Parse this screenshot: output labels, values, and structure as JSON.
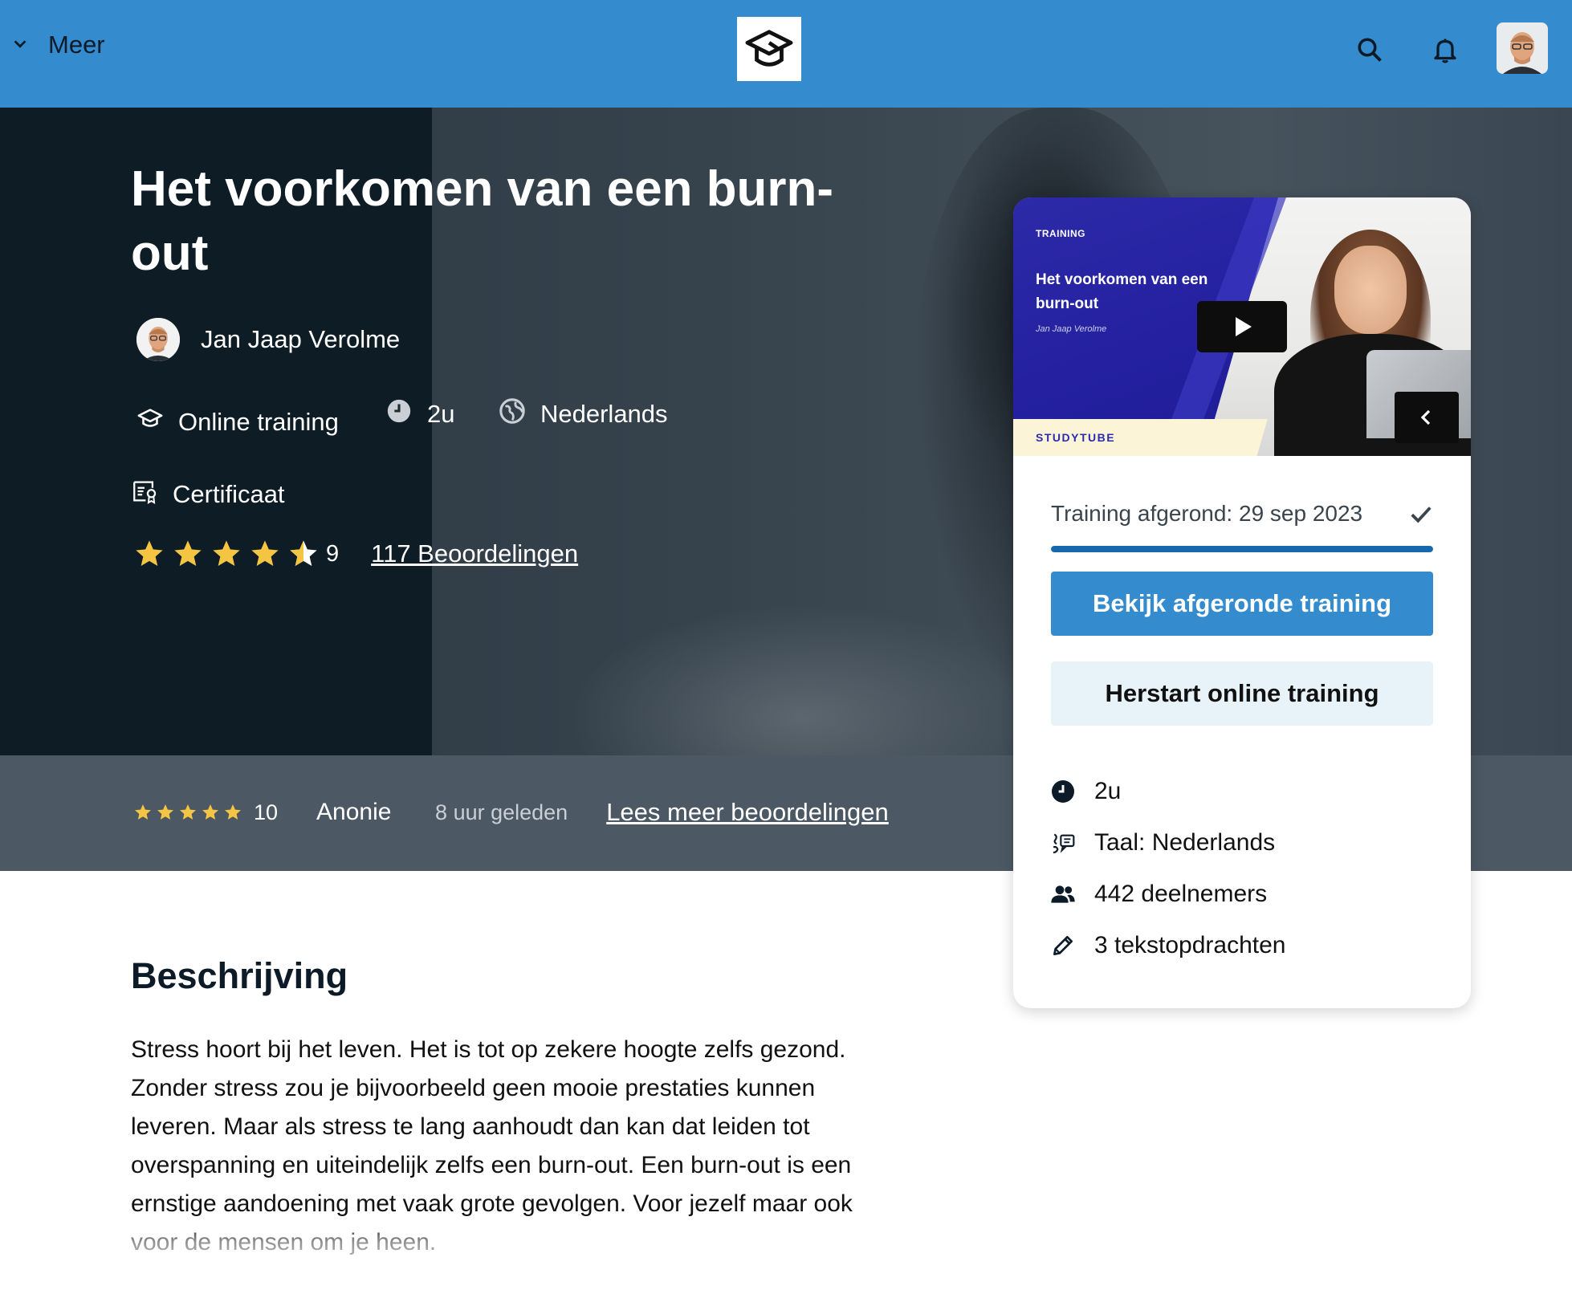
{
  "nav": {
    "menu_label": "Meer",
    "icons": [
      "chevron-down-icon",
      "studytube-logo",
      "search-icon",
      "bell-icon",
      "user-avatar"
    ]
  },
  "course": {
    "title": "Het voorkomen van een burn-out",
    "author": "Jan Jaap Verolme",
    "type": "Online training",
    "duration": "2u",
    "language": "Nederlands",
    "certificate": "Certificaat",
    "rating_value": "9",
    "rating_stars": 4.5,
    "reviews_link": "117 Beoordelingen"
  },
  "review": {
    "stars": 5,
    "score": "10",
    "author": "Anonie",
    "time": "8 uur geleden",
    "more_link": "Lees meer beoordelingen"
  },
  "description": {
    "heading": "Beschrijving",
    "text": "Stress hoort bij het leven. Het is tot op zekere hoogte zelfs gezond. Zonder stress zou je bijvoorbeeld geen mooie prestaties kunnen leveren. Maar als stress te lang aanhoudt dan kan dat leiden tot overspanning en uiteindelijk zelfs een burn-out. Een burn-out is een ernstige aandoening met vaak grote gevolgen. Voor jezelf maar ook voor de mensen om je heen."
  },
  "card": {
    "thumb": {
      "label": "TRAINING",
      "title": "Het voorkomen van een burn-out",
      "author": "Jan Jaap Verolme",
      "brand": "STUDYTUBE"
    },
    "completed_text": "Training afgerond: 29 sep 2023",
    "progress": 1.0,
    "primary_button": "Bekijk afgeronde training",
    "secondary_button": "Herstart online training",
    "info": {
      "duration": "2u",
      "language": "Taal: Nederlands",
      "participants": "442 deelnemers",
      "assignments": "3 tekstopdrachten"
    }
  },
  "colors": {
    "nav_bg": "#348ccf",
    "hero_shade": "#0e1c25",
    "star": "#f4c542",
    "primary_button": "#348ccf",
    "secondary_button": "#e8f2f9",
    "progress": "#1768ac"
  }
}
